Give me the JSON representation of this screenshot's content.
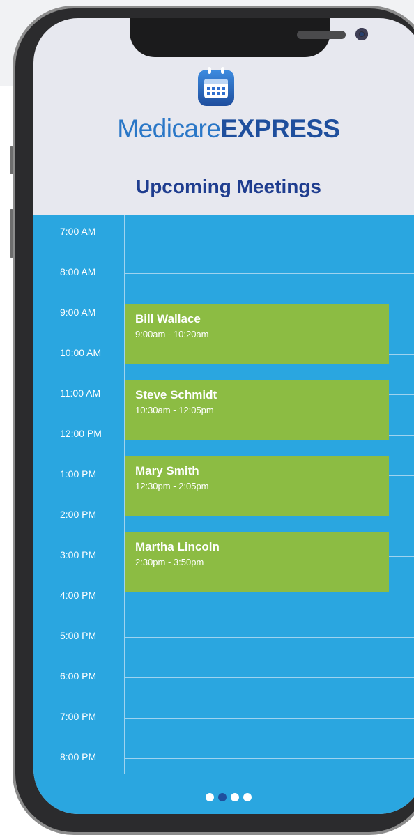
{
  "app": {
    "brand_part1": "Medicare",
    "brand_part2": "EXPRESS",
    "icon": "calendar-icon"
  },
  "page": {
    "title": "Upcoming Meetings"
  },
  "schedule": {
    "hours": [
      "7:00 AM",
      "8:00 AM",
      "9:00 AM",
      "10:00 AM",
      "11:00 AM",
      "12:00 PM",
      "1:00 PM",
      "2:00 PM",
      "3:00 PM",
      "4:00 PM",
      "5:00 PM",
      "6:00 PM",
      "7:00 PM",
      "8:00 PM"
    ],
    "meetings": [
      {
        "name": "Bill Wallace",
        "time": "9:00am - 10:20am"
      },
      {
        "name": "Steve Schmidt",
        "time": "10:30am - 12:05pm"
      },
      {
        "name": "Mary Smith",
        "time": "12:30pm - 2:05pm"
      },
      {
        "name": "Martha Lincoln",
        "time": "2:30pm - 3:50pm"
      }
    ]
  },
  "pagination": {
    "count": 4,
    "active_index": 1
  },
  "colors": {
    "accent": "#2aa6e0",
    "meeting": "#8cbc43",
    "brand_dark": "#1f4f9d",
    "brand_light": "#2a77c7",
    "heading": "#1f3d8f",
    "header_bg": "#e7e8ef"
  }
}
